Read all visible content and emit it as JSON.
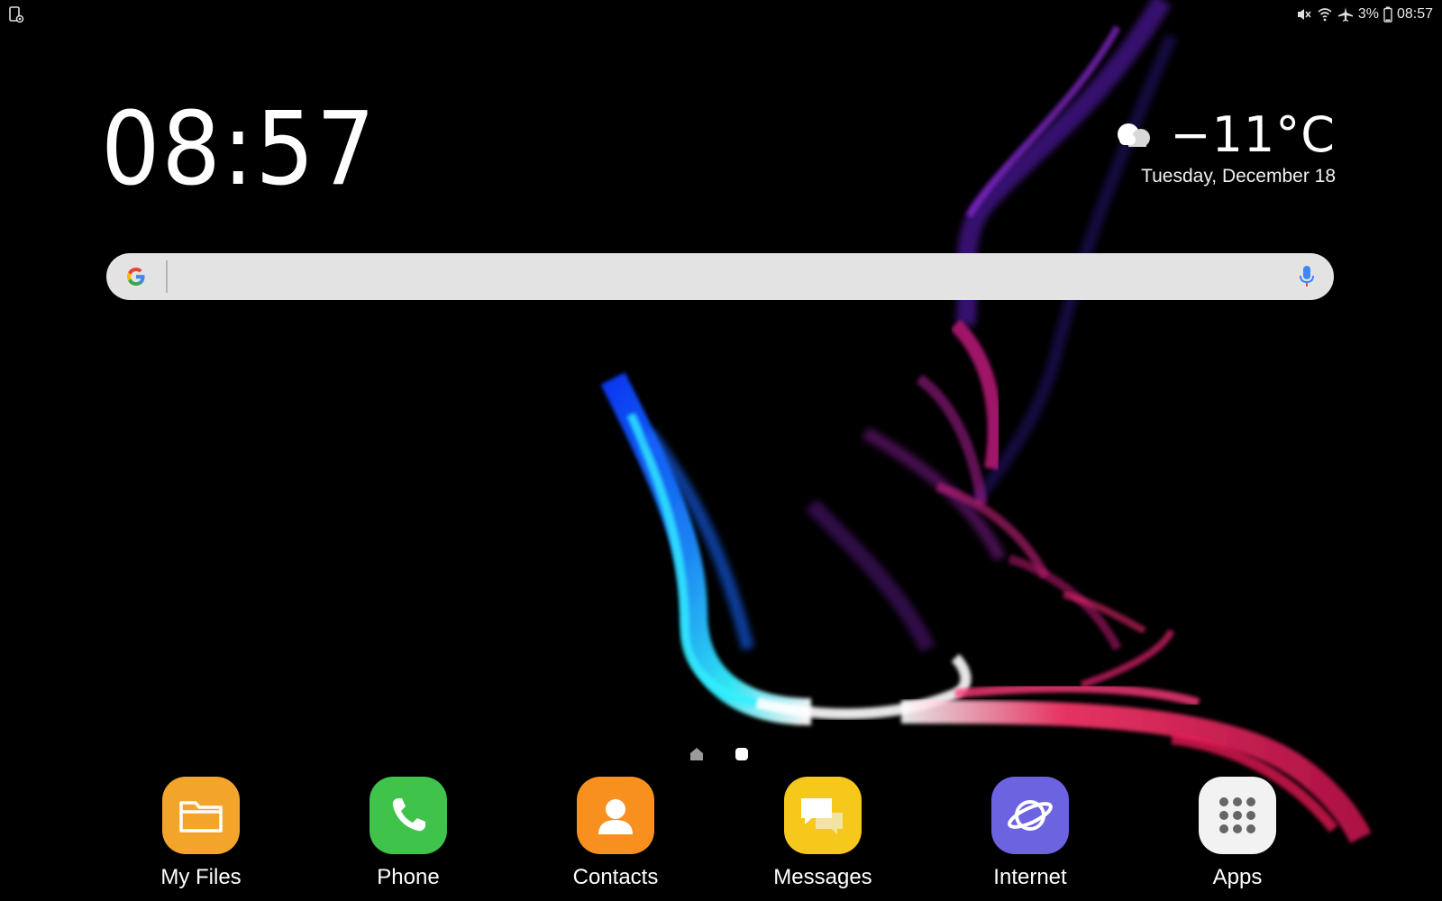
{
  "status_bar": {
    "battery_percent": "3%",
    "time": "08:57",
    "icons": [
      "screen-recorder-icon",
      "mute-icon",
      "wifi-icon",
      "airplane-mode-icon",
      "battery-icon"
    ]
  },
  "clock_widget": {
    "time": "08:57",
    "temperature": "−11°C",
    "weather_icon": "cloud-icon",
    "date": "Tuesday, December 18"
  },
  "search": {
    "placeholder": "",
    "value": "",
    "icons": [
      "google-g-icon",
      "microphone-icon"
    ]
  },
  "page_indicator": {
    "pages": [
      "home",
      "page"
    ],
    "current": 1
  },
  "dock": {
    "apps": [
      {
        "label": "My Files",
        "icon": "folder-icon",
        "color": "#f2a52a"
      },
      {
        "label": "Phone",
        "icon": "phone-icon",
        "color": "#3fc34b"
      },
      {
        "label": "Contacts",
        "icon": "person-icon",
        "color": "#f7901e"
      },
      {
        "label": "Messages",
        "icon": "chat-bubbles-icon",
        "color": "#f7c81c"
      },
      {
        "label": "Internet",
        "icon": "planet-icon",
        "color": "#6b63e0"
      },
      {
        "label": "Apps",
        "icon": "grid-icon",
        "color": "#f2f2f2"
      }
    ]
  },
  "colors": {
    "background": "#000000",
    "search_bar": "#e3e3e3",
    "wallpaper_blue": "#1e8cff",
    "wallpaper_cyan": "#33f0ff",
    "wallpaper_pink": "#ff1a7a",
    "wallpaper_purple": "#7a2bd9"
  }
}
